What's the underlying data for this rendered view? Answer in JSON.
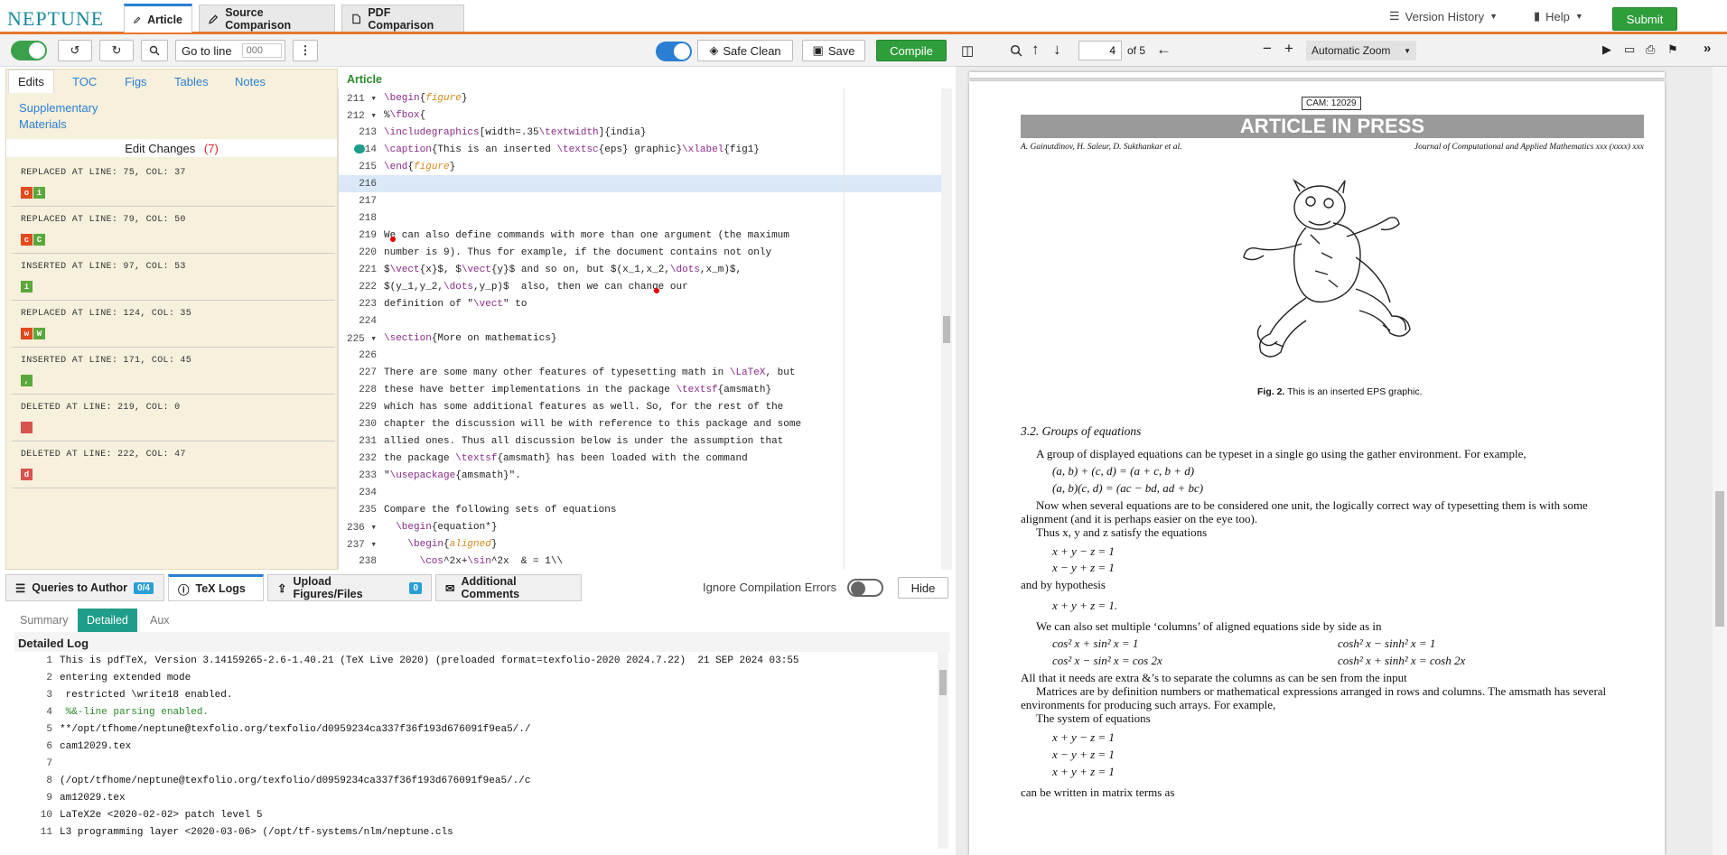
{
  "app": {
    "logo": "NEPTUNE",
    "tabs": [
      {
        "label": "Article"
      },
      {
        "label": "Source Comparison"
      },
      {
        "label": "PDF Comparison"
      }
    ],
    "menu": {
      "version_history": "Version History",
      "help": "Help",
      "submit": "Submit"
    }
  },
  "toolbar": {
    "goto_label": "Go to line",
    "goto_placeholder": "000",
    "safe_clean": "Safe Clean",
    "save": "Save",
    "compile": "Compile"
  },
  "left": {
    "tabs": [
      "Edits",
      "TOC",
      "Figs",
      "Tables",
      "Notes"
    ],
    "supp1": "Supplementary",
    "supp2": "Materials",
    "title": "Edit Changes",
    "count": "(7)",
    "changes": [
      {
        "type": "REPLACED",
        "where": "AT LINE: 75, COL: 37",
        "chips": [
          [
            "red",
            "o"
          ],
          [
            "green",
            "i"
          ]
        ]
      },
      {
        "type": "REPLACED",
        "where": "AT LINE: 79, COL: 50",
        "chips": [
          [
            "red",
            "c"
          ],
          [
            "green",
            "C"
          ]
        ]
      },
      {
        "type": "INSERTED",
        "where": "AT LINE: 97, COL: 53",
        "chips": [
          [
            "green",
            "i"
          ]
        ]
      },
      {
        "type": "REPLACED",
        "where": "AT LINE: 124, COL: 35",
        "chips": [
          [
            "red",
            "w"
          ],
          [
            "green",
            "W"
          ]
        ]
      },
      {
        "type": "INSERTED",
        "where": "AT LINE: 171, COL: 45",
        "chips": [
          [
            "green",
            ","
          ]
        ]
      },
      {
        "type": "DELETED",
        "where": "AT LINE: 219, COL: 0",
        "chips": [
          [
            "pink",
            ""
          ]
        ]
      },
      {
        "type": "DELETED",
        "where": "AT LINE: 222, COL: 47",
        "chips": [
          [
            "pink",
            "d"
          ]
        ]
      }
    ]
  },
  "editor": {
    "header": "Article",
    "lines": [
      {
        "n": "211",
        "fold": true,
        "t": "\\begin{figure}"
      },
      {
        "n": "212",
        "fold": true,
        "t": "%\\fbox{"
      },
      {
        "n": "213",
        "t": "\\includegraphics[width=.35\\textwidth]{india}"
      },
      {
        "n": "214",
        "t": "\\caption{This is an inserted \\textsc{eps} graphic}\\xlabel{fig1}"
      },
      {
        "n": "215",
        "t": "\\end{figure}"
      },
      {
        "n": "216",
        "t": "",
        "hl": true
      },
      {
        "n": "217",
        "t": ""
      },
      {
        "n": "218",
        "t": ""
      },
      {
        "n": "219",
        "t": "We can also define commands with more than one argument (the maximum"
      },
      {
        "n": "220",
        "t": "number is 9). Thus for example, if the document contains not only"
      },
      {
        "n": "221",
        "t": "$\\vect{x}$, $\\vect{y}$ and so on, but $(x_1,x_2,\\dots,x_m)$,"
      },
      {
        "n": "222",
        "t": "$(y_1,y_2,\\dots,y_p)$  also, then we can change our"
      },
      {
        "n": "223",
        "t": "definition of \"\\vect\" to"
      },
      {
        "n": "224",
        "t": ""
      },
      {
        "n": "225",
        "fold": true,
        "t": "\\section{More on mathematics}"
      },
      {
        "n": "226",
        "t": ""
      },
      {
        "n": "227",
        "t": "There are some many other features of typesetting math in \\LaTeX, but"
      },
      {
        "n": "228",
        "t": "these have better implementations in the package \\textsf{amsmath}"
      },
      {
        "n": "229",
        "t": "which has some additional features as well. So, for the rest of the"
      },
      {
        "n": "230",
        "t": "chapter the discussion will be with reference to this package and some"
      },
      {
        "n": "231",
        "t": "allied ones. Thus all discussion below is under the assumption that"
      },
      {
        "n": "232",
        "t": "the package \\textsf{amsmath} has been loaded with the command"
      },
      {
        "n": "233",
        "t": "\"\\usepackage{amsmath}\"."
      },
      {
        "n": "234",
        "t": ""
      },
      {
        "n": "235",
        "t": "Compare the following sets of equations"
      },
      {
        "n": "236",
        "fold": true,
        "t": "  \\begin{equation*}"
      },
      {
        "n": "237",
        "fold": true,
        "t": "    \\begin{aligned}"
      },
      {
        "n": "238",
        "t": "      \\cos^2x+\\sin^2x  & = 1\\\\"
      }
    ]
  },
  "bottom": {
    "tabs": [
      {
        "label": "Queries to Author",
        "badge": "0/4"
      },
      {
        "label": "TeX Logs"
      },
      {
        "label": "Upload Figures/Files",
        "badge": "0"
      },
      {
        "label": "Additional Comments"
      }
    ],
    "ignore": "Ignore Compilation Errors",
    "hide": "Hide",
    "subtabs": [
      "Summary",
      "Detailed",
      "Aux"
    ],
    "log_title": "Detailed Log",
    "log": [
      {
        "n": "1",
        "t": "This is pdfTeX, Version 3.14159265-2.6-1.40.21 (TeX Live 2020) (preloaded format=texfolio-2020 2024.7.22)  21 SEP 2024 03:55"
      },
      {
        "n": "2",
        "t": "entering extended mode"
      },
      {
        "n": "3",
        "t": " restricted \\write18 enabled."
      },
      {
        "n": "4",
        "t": " %&-line parsing enabled."
      },
      {
        "n": "5",
        "t": "**/opt/tfhome/neptune@texfolio.org/texfolio/d0959234ca337f36f193d676091f9ea5/./"
      },
      {
        "n": "6",
        "t": "cam12029.tex"
      },
      {
        "n": "7",
        "t": ""
      },
      {
        "n": "8",
        "t": "(/opt/tfhome/neptune@texfolio.org/texfolio/d0959234ca337f36f193d676091f9ea5/./c"
      },
      {
        "n": "9",
        "t": "am12029.tex"
      },
      {
        "n": "10",
        "t": "LaTeX2e <2020-02-02> patch level 5"
      },
      {
        "n": "11",
        "t": "L3 programming layer <2020-03-06> (/opt/tf-systems/nlm/neptune.cls"
      }
    ]
  },
  "pdf": {
    "page": "4",
    "of": "of 5",
    "zoom": "Automatic Zoom",
    "cam": "CAM: 12029",
    "banner": "ARTICLE IN PRESS",
    "authors": "A. Gainutdinov, H. Saleur, D. Sukthankar et al.",
    "journal": "Journal of Computational and Applied Mathematics xxx (xxxx) xxx",
    "fig_label": "Fig. 2.",
    "fig_caption": "This is an inserted EPS graphic.",
    "section": "3.2.  Groups of equations",
    "p1": "A group of displayed equations can be typeset in a single go using the gather environment. For example,",
    "e1": "(a, b) + (c, d) = (a + c, b + d)",
    "e2": "(a, b)(c, d) = (ac − bd, ad + bc)",
    "p2": "Now when several equations are to be considered one unit, the logically correct way of typesetting them is with some",
    "p2b": "alignment (and it is perhaps easier on the eye too).",
    "p3": "Thus x, y and z satisfy the equations",
    "e3": "x + y − z = 1",
    "e4": "x − y + z = 1",
    "p4": "and by hypothesis",
    "e5": "x + y + z = 1.",
    "p5": "We can also set multiple ‘columns’ of aligned equations side by side as in",
    "e6a": "cos² x + sin² x = 1",
    "e6b": "cosh² x − sinh² x = 1",
    "e7a": "cos² x − sin² x = cos 2x",
    "e7b": "cosh² x + sinh² x = cosh 2x",
    "p6": "All that it needs are extra &’s to separate the columns as can be sen from the input",
    "p7": "Matrices are by definition numbers or mathematical expressions arranged in rows and columns. The amsmath has several",
    "p7b": "environments for producing such arrays. For example,",
    "p8": "The system of equations",
    "e8": "x + y − z = 1",
    "e9": "x − y + z = 1",
    "e10": "x + y + z = 1",
    "p9": "can be written in matrix terms as"
  }
}
